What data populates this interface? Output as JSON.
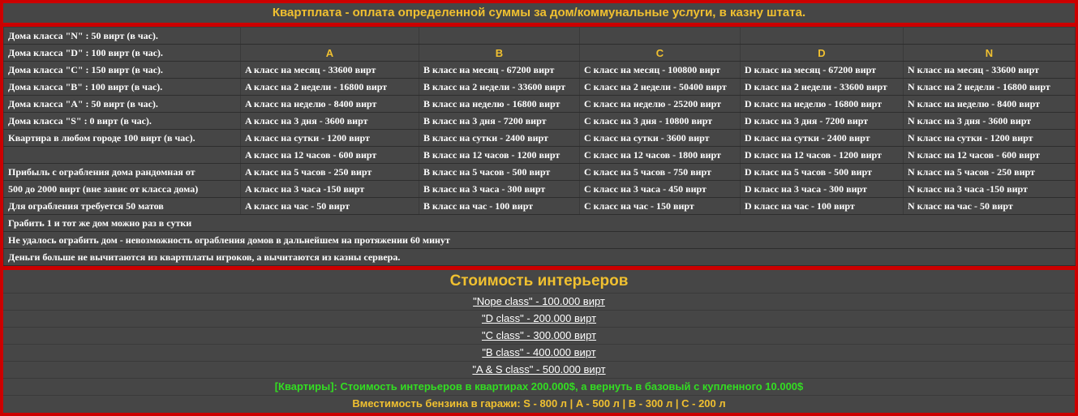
{
  "title": "Квартплата - оплата определенной суммы за дом/коммунальные услуги, в казну штата.",
  "rates": {
    "rows": [
      [
        "Дома класса \"N\" : 50 вирт (в час).",
        "",
        "",
        "",
        "",
        ""
      ],
      [
        "Дома класса \"D\" : 100 вирт (в час).",
        "A",
        "B",
        "C",
        "D",
        "N"
      ],
      [
        "Дома класса \"C\" : 150 вирт (в час).",
        "A класс на месяц - 33600 вирт",
        "B класс на месяц - 67200 вирт",
        "C класс на месяц - 100800 вирт",
        "D класс на месяц - 67200 вирт",
        "N класс на месяц - 33600 вирт"
      ],
      [
        "Дома класса \"B\" : 100 вирт (в час).",
        "A класс на 2 недели - 16800 вирт",
        "B класс на 2 недели - 33600 вирт",
        "C класс на 2 недели - 50400 вирт",
        "D класс на 2 недели - 33600 вирт",
        "N класс на 2 недели - 16800 вирт"
      ],
      [
        "Дома класса \"A\" : 50 вирт (в час).",
        "A класс на неделю - 8400 вирт",
        "B класс на неделю - 16800 вирт",
        "C класс на неделю - 25200 вирт",
        "D класс на неделю - 16800 вирт",
        "N класс на неделю - 8400 вирт"
      ],
      [
        "Дома класса \"S\" : 0 вирт (в час).",
        "A класс на 3 дня - 3600 вирт",
        "B класс на 3 дня - 7200 вирт",
        "C класс на 3 дня - 10800 вирт",
        "D класс на 3 дня - 7200 вирт",
        "N класс на 3 дня - 3600 вирт"
      ],
      [
        "Квартира в любом городе 100 вирт (в час).",
        "A класс на сутки - 1200 вирт",
        "B класс на сутки - 2400 вирт",
        "C класс на сутки - 3600 вирт",
        "D класс на сутки - 2400 вирт",
        "N класс на сутки - 1200 вирт"
      ],
      [
        "",
        "A класс на 12 часов - 600 вирт",
        "B класс на 12 часов - 1200 вирт",
        "C класс на 12 часов - 1800 вирт",
        "D класс на 12 часов - 1200 вирт",
        "N класс на 12 часов - 600 вирт"
      ],
      [
        "Прибыль с ограбления дома рандомная от",
        "A класс на 5 часов - 250 вирт",
        "B класс на 5 часов - 500 вирт",
        "C класс на 5 часов - 750 вирт",
        "D класс на 5 часов - 500 вирт",
        "N класс на 5 часов - 250 вирт"
      ],
      [
        "500 до 2000 вирт (вне завис от класса дома)",
        "A класс на 3 часа -150 вирт",
        "B класс на 3 часа - 300 вирт",
        "C класс на 3 часа - 450 вирт",
        "D класс на 3 часа - 300 вирт",
        "N класс на 3 часа -150 вирт"
      ],
      [
        "Для ограбления требуется 50 матов",
        "A класс на час - 50 вирт",
        "B класс на час - 100 вирт",
        "C класс на час - 150 вирт",
        "D класс на час - 100 вирт",
        "N класс на час - 50 вирт"
      ]
    ],
    "notes": [
      "Грабить 1 и тот же дом можно раз в сутки",
      "Не удалось ограбить дом - невозможность ограбления домов в дальнейшем на протяжении 60 минут",
      "Деньги больше не вычитаются из квартплаты игроков, а вычитаются из казны сервера."
    ]
  },
  "interiors": {
    "title": "Стоимость интерьеров",
    "items": [
      "\"Nope class\" - 100.000 вирт",
      "\"D class\" - 200.000 вирт",
      "\"C class\" - 300.000 вирт",
      "\"B class\" - 400.000 вирт",
      "\"A & S class\" - 500.000 вирт"
    ],
    "apartments_note": "[Квартиры]: Стоимость интерьеров в квартирах 200.000$, а вернуть в базовый с купленного 10.000$",
    "garage_note": "Вместимость бензина в гаражи: S - 800 л | A - 500 л | B - 300 л | C - 200 л"
  },
  "colors": {
    "border": "#cc0000",
    "panel": "#464646",
    "accent": "#f0c030",
    "green": "#33dd22"
  }
}
